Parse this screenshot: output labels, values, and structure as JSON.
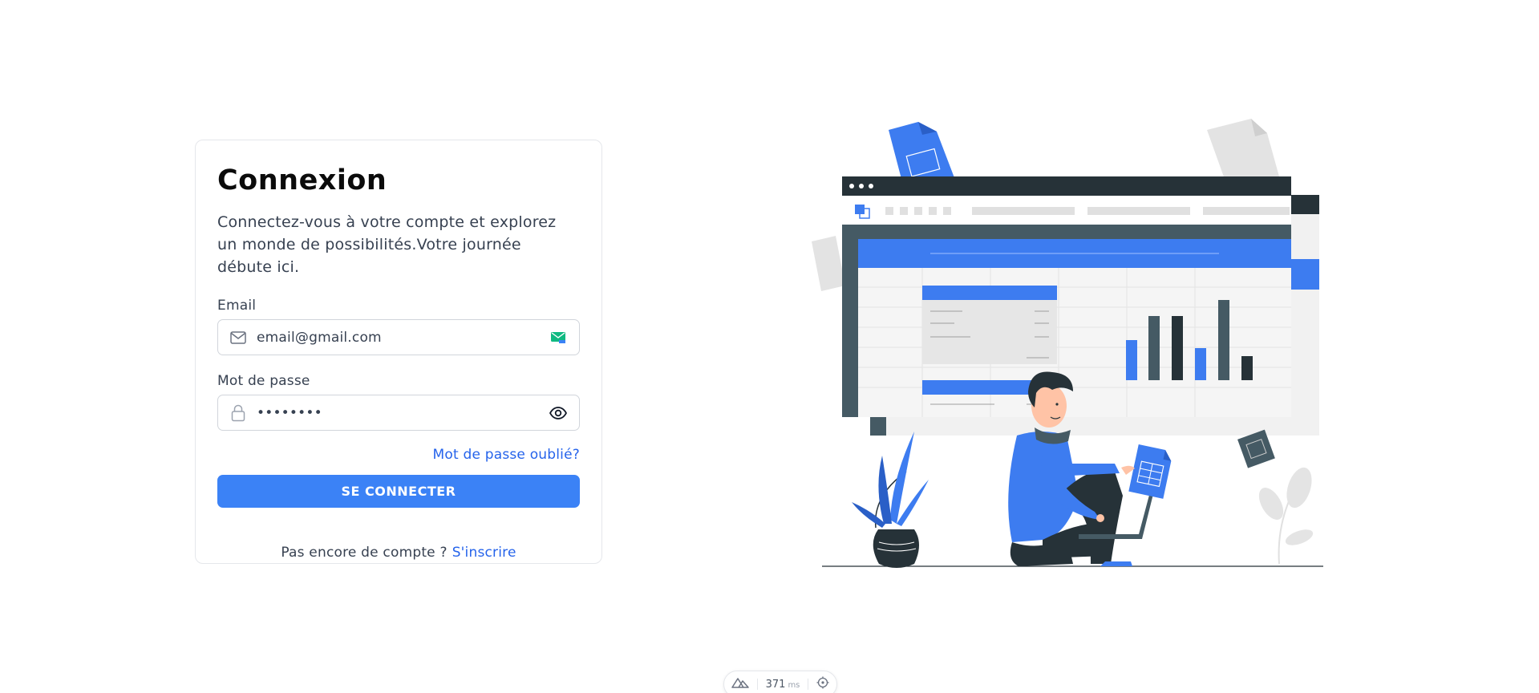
{
  "login": {
    "title": "Connexion",
    "subtitle": "Connectez-vous à votre compte et explorez un monde de possibilités.Votre journée débute ici.",
    "email": {
      "label": "Email",
      "value": "email@gmail.com",
      "lead_icon": "mail-icon",
      "trail_icon": "mail-badge-icon"
    },
    "password": {
      "label": "Mot de passe",
      "value": "••••••••",
      "lead_icon": "lock-icon",
      "trail_icon": "eye-icon"
    },
    "forgot_link": "Mot de passe oublié?",
    "submit_label": "SE CONNECTER",
    "signup_prompt": "Pas encore de compte ?",
    "signup_link": "S'inscrire"
  },
  "devtools": {
    "logo_icon": "nuxt-icon",
    "timing_value": "371",
    "timing_unit": "ms",
    "inspect_icon": "crosshair-icon"
  },
  "colors": {
    "accent": "#3b82f6",
    "link": "#2563eb",
    "illustration_dark": "#263238",
    "mail_badge": "#10b981"
  }
}
